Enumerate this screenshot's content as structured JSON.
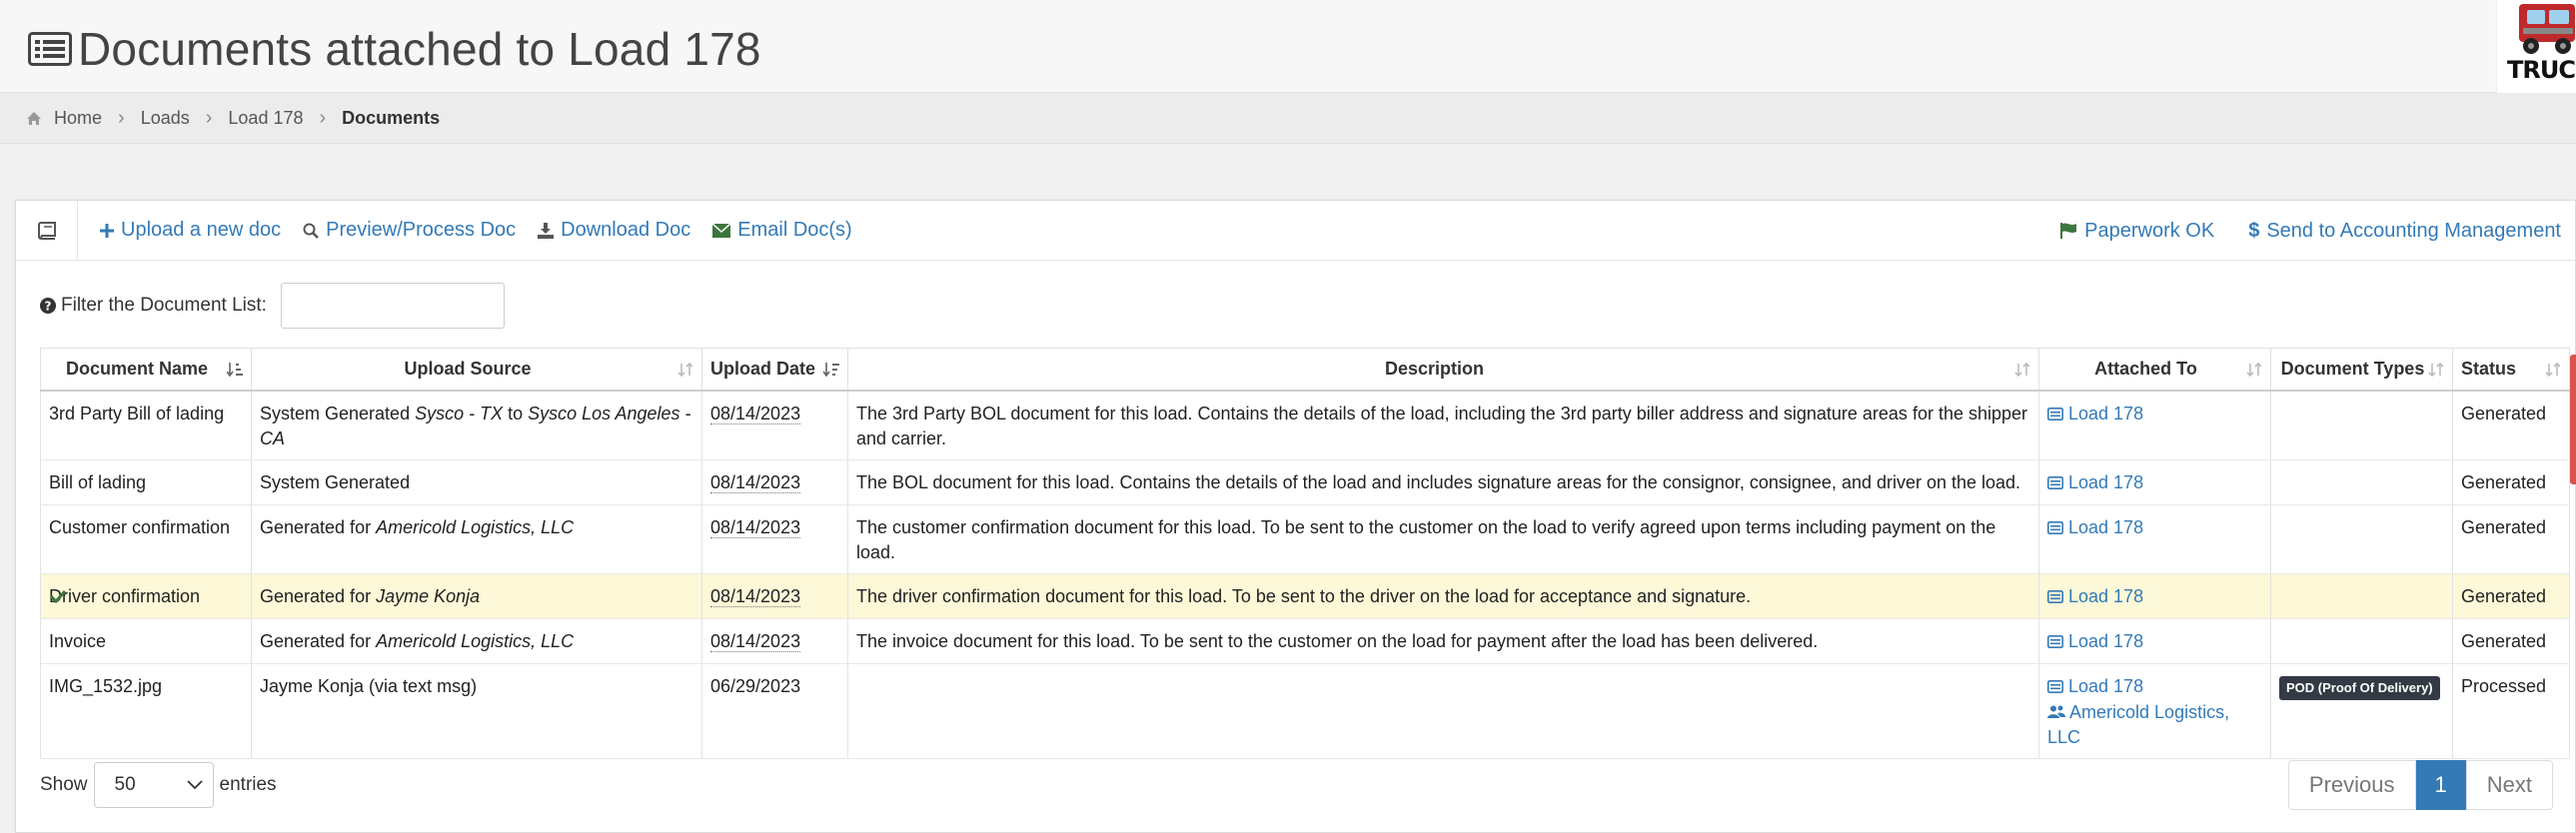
{
  "header": {
    "title": "Documents attached to Load 178",
    "logo_text": "TRUCK"
  },
  "breadcrumb": {
    "items": [
      "Home",
      "Loads",
      "Load 178",
      "Documents"
    ]
  },
  "toolbar": {
    "upload": "Upload a new doc",
    "preview": "Preview/Process Doc",
    "download": "Download Doc",
    "email": "Email Doc(s)",
    "paperwork": "Paperwork OK",
    "accounting": "Send to Accounting Management"
  },
  "filter": {
    "label": "Filter the Document List:",
    "value": ""
  },
  "table": {
    "columns": [
      "Document Name",
      "Upload Source",
      "Upload Date",
      "Description",
      "Attached To",
      "Document Types",
      "Status"
    ],
    "rows": [
      {
        "name": "3rd Party Bill of lading",
        "source_prefix": "System Generated ",
        "source_em1": "Sysco - TX",
        "source_mid": " to ",
        "source_em2": "Sysco Los Angeles - CA",
        "date": "08/14/2023",
        "description": "The 3rd Party BOL document for this load. Contains the details of the load, including the 3rd party biller address and signature areas for the shipper and carrier.",
        "attached": "Load 178",
        "type": "",
        "status": "Generated"
      },
      {
        "name": "Bill of lading",
        "source_prefix": "System Generated",
        "date": "08/14/2023",
        "description": "The BOL document for this load. Contains the details of the load and includes signature areas for the consignor, consignee, and driver on the load.",
        "attached": "Load 178",
        "type": "",
        "status": "Generated"
      },
      {
        "name": "Customer confirmation",
        "source_prefix": "Generated for ",
        "source_em1": "Americold Logistics, LLC",
        "date": "08/14/2023",
        "description": "The customer confirmation document for this load. To be sent to the customer on the load to verify agreed upon terms including payment on the load.",
        "attached": "Load 178",
        "type": "",
        "status": "Generated"
      },
      {
        "name": "Driver confirmation",
        "source_prefix": "Generated for ",
        "source_em1": "Jayme Konja",
        "date": "08/14/2023",
        "description": "The driver confirmation document for this load. To be sent to the driver on the load for acceptance and signature.",
        "attached": "Load 178",
        "type": "",
        "status": "Generated"
      },
      {
        "name": "Invoice",
        "source_prefix": "Generated for ",
        "source_em1": "Americold Logistics, LLC",
        "date": "08/14/2023",
        "description": "The invoice document for this load. To be sent to the customer on the load for payment after the load has been delivered.",
        "attached": "Load 178",
        "type": "",
        "status": "Generated"
      },
      {
        "name": "IMG_1532.jpg",
        "source_prefix": "Jayme Konja (via text msg)",
        "date": "06/29/2023",
        "description": "",
        "attached": "Load 178",
        "attached2": "Americold Logistics, LLC",
        "type": "POD (Proof Of Delivery)",
        "status": "Processed"
      }
    ]
  },
  "footer": {
    "show_label": "Show",
    "entries_value": "50",
    "entries_label": "entries",
    "prev": "Previous",
    "page": "1",
    "next": "Next"
  },
  "colors": {
    "link": "#337ab7",
    "highlight_row": "#fcf8d8",
    "badge": "#333a44",
    "check": "#3c763d"
  }
}
